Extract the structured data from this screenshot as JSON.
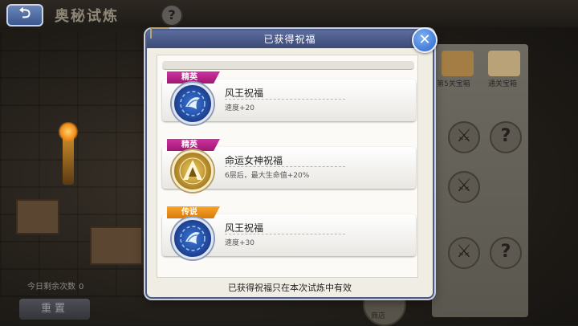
{
  "page": {
    "title": "奥秘试炼",
    "back_glyph": "⮌",
    "help_glyph": "?"
  },
  "left_panel": {
    "remaining_label": "今日剩余次数",
    "remaining_value": "0",
    "reset_label": "重置"
  },
  "map": {
    "chest_labels": [
      "第5关宝箱",
      "通关宝箱"
    ],
    "shop_label": "商店",
    "node_glyphs": [
      "?",
      "?"
    ]
  },
  "dialog": {
    "title": "已获得祝福",
    "close_glyph": "✕",
    "footer": "已获得祝福只在本次试炼中有效",
    "blessings": [
      {
        "tier": "精英",
        "tier_type": "elite",
        "name": "风王祝福",
        "desc": "速度+20",
        "icon": "wind-king-icon"
      },
      {
        "tier": "精英",
        "tier_type": "elite",
        "name": "命运女神祝福",
        "desc": "6层后，最大生命值+20%",
        "icon": "fate-goddess-icon"
      },
      {
        "tier": "传说",
        "tier_type": "legend",
        "name": "风王祝福",
        "desc": "速度+30",
        "icon": "wind-king-icon"
      }
    ]
  },
  "colors": {
    "elite_tag": "#c02a8f",
    "legend_tag": "#f29420",
    "header_blue": "#4b5b8c"
  }
}
